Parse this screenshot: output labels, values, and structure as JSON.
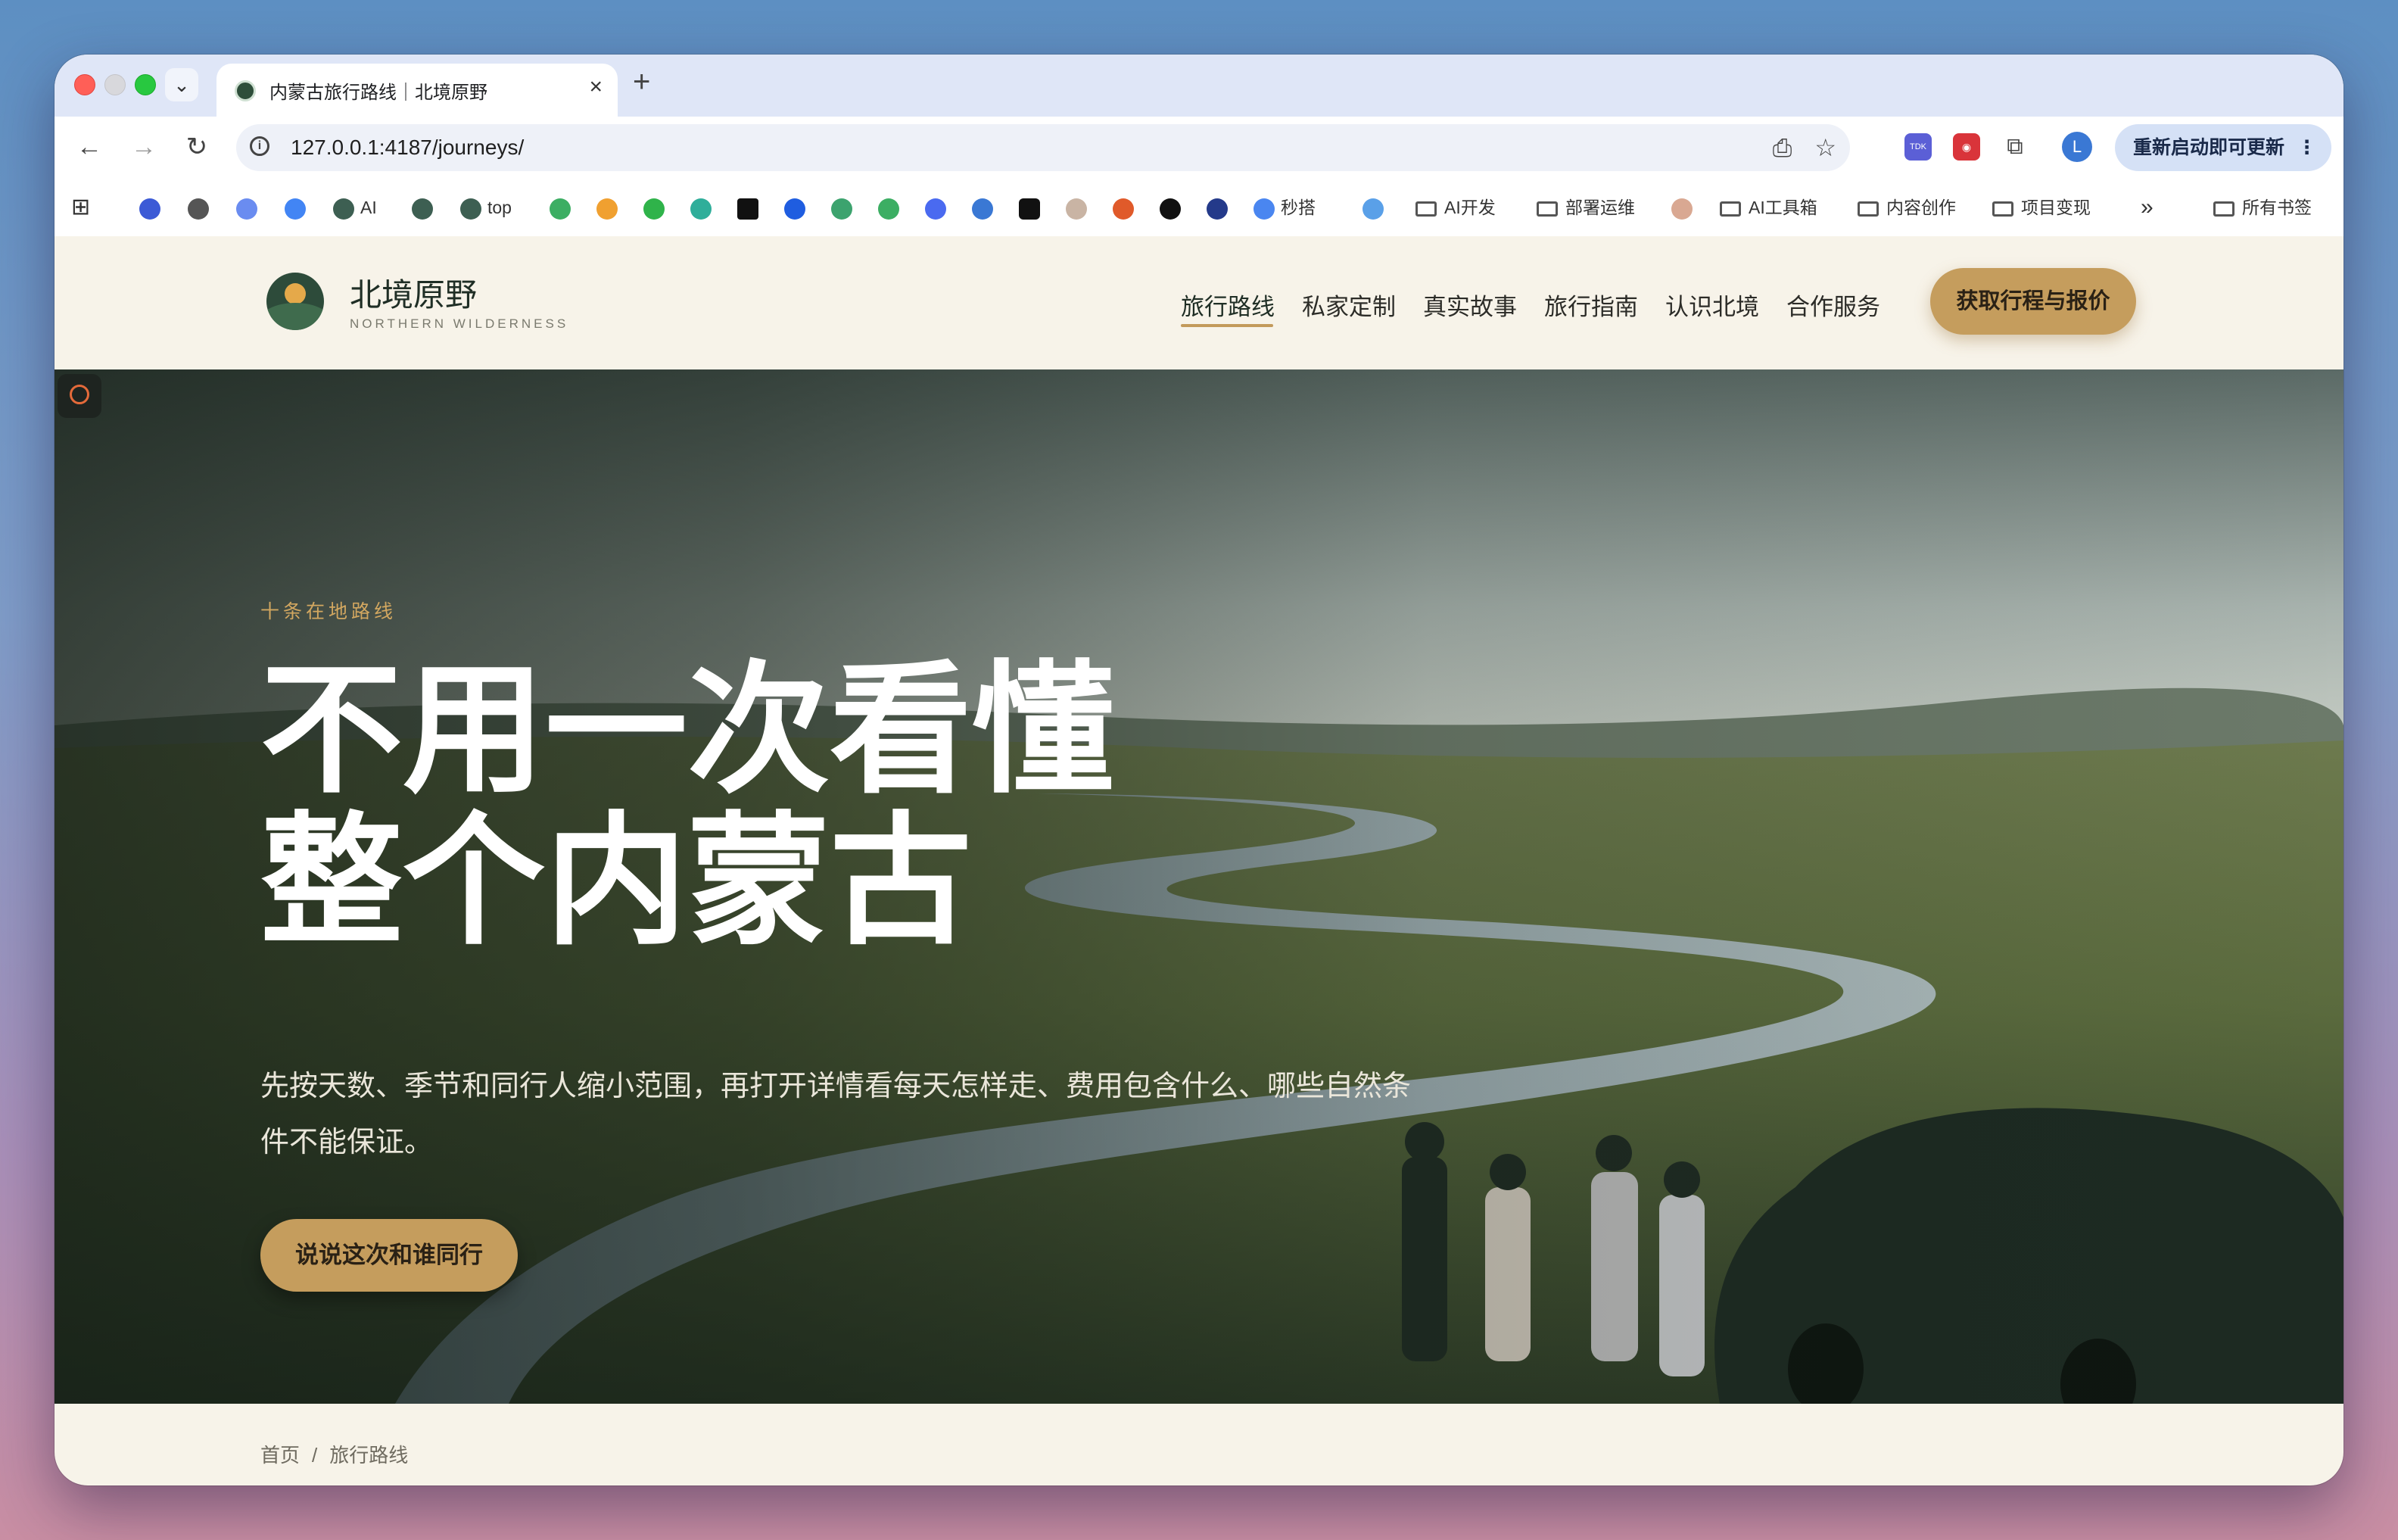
{
  "browser": {
    "tab_title": "内蒙古旅行路线｜北境原野",
    "url": "127.0.0.1:4187/journeys/",
    "update_label": "重新启动即可更新",
    "avatar_letter": "L",
    "bookmarks": [
      {
        "label": "AI",
        "icon": "ai-icon"
      },
      {
        "label": "top",
        "icon": "top-icon"
      },
      {
        "label": "秒搭",
        "icon": "miaoda-icon"
      },
      {
        "label": "AI开发",
        "icon": "folder-icon"
      },
      {
        "label": "部署运维",
        "icon": "folder-icon"
      },
      {
        "label": "AI工具箱",
        "icon": "folder-icon"
      },
      {
        "label": "内容创作",
        "icon": "folder-icon"
      },
      {
        "label": "项目变现",
        "icon": "folder-icon"
      },
      {
        "label": "所有书签",
        "icon": "folder-icon"
      }
    ],
    "more_bookmarks": "»"
  },
  "site": {
    "brand_name": "北境原野",
    "brand_sub": "NORTHERN WILDERNESS",
    "nav": [
      {
        "label": "旅行路线",
        "active": true
      },
      {
        "label": "私家定制",
        "active": false
      },
      {
        "label": "真实故事",
        "active": false
      },
      {
        "label": "旅行指南",
        "active": false
      },
      {
        "label": "认识北境",
        "active": false
      },
      {
        "label": "合作服务",
        "active": false
      }
    ],
    "cta": "获取行程与报价"
  },
  "hero": {
    "eyebrow": "十条在地路线",
    "headline_line1": "不用一次看懂",
    "headline_line2": "整个内蒙古",
    "lead": "先按天数、季节和同行人缩小范围，再打开详情看每天怎样走、费用包含什么、哪些自然条件不能保证。",
    "cta": "说说这次和谁同行"
  },
  "breadcrumb": {
    "home": "首页",
    "separator": "/",
    "current": "旅行路线"
  },
  "colors": {
    "accent_gold": "#c59d5d",
    "brand_green": "#2d4b3a",
    "page_bg": "#f7f3e9"
  }
}
